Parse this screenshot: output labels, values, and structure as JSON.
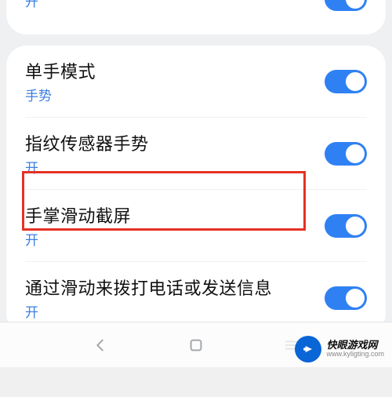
{
  "colors": {
    "accent": "#2f81f3",
    "link": "#3a7fe0",
    "highlight": "#e53223"
  },
  "card_top": {
    "item0": {
      "title": "",
      "sub": "开",
      "toggle": true
    }
  },
  "card_main": {
    "item0": {
      "title": "单手模式",
      "sub": "手势",
      "toggle": true
    },
    "item1": {
      "title": "指纹传感器手势",
      "sub": "开",
      "toggle": true
    },
    "item2": {
      "title": "手掌滑动截屏",
      "sub": "开",
      "toggle": true
    },
    "item3": {
      "title": "通过滑动来拨打电话或发送信息",
      "sub": "开",
      "toggle": true
    }
  },
  "highlight_target": "palm-swipe-screenshot",
  "watermark": {
    "line1": "快眼游戏网",
    "line2": "www.kyligting.com"
  }
}
